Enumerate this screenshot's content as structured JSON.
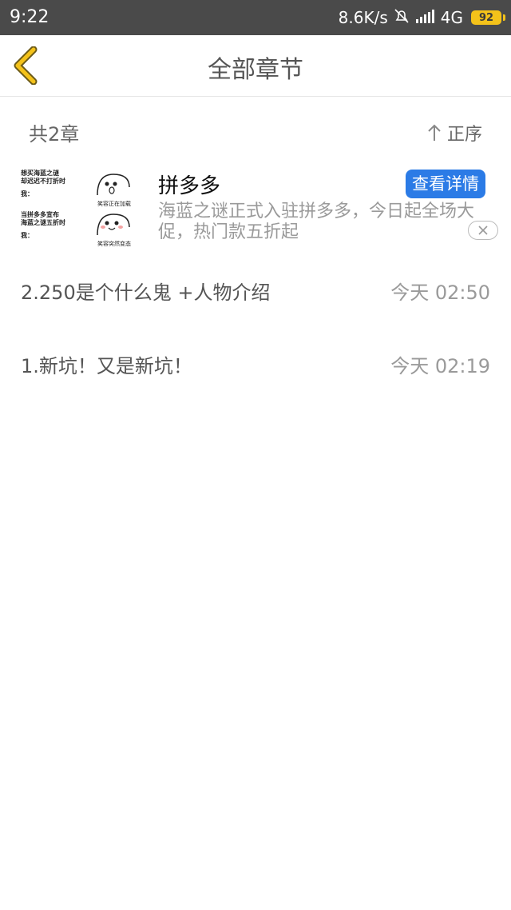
{
  "status": {
    "time": "9:22",
    "speed": "8.6K/s",
    "network": "4G",
    "battery": "92"
  },
  "nav": {
    "title": "全部章节"
  },
  "summary": {
    "count_label": "共2章",
    "sort_label": "正序"
  },
  "ad": {
    "title": "拼多多",
    "description": "海蓝之谜正式入驻拼多多，今日起全场大促，热门款五折起",
    "button_label": "查看详情",
    "image_lines_top": [
      "想买海蓝之谜",
      "却迟迟不打折时",
      "我："
    ],
    "image_lines_bottom": [
      "当拼多多宣布",
      "海蓝之谜五折时",
      "我："
    ],
    "face_caption_top": "笑容正在加载",
    "face_caption_bottom": "笑容突然变态"
  },
  "chapters": [
    {
      "name": "2.250是个什么鬼 +人物介绍",
      "time": "今天 02:50"
    },
    {
      "name": "1.新坑！又是新坑！",
      "time": "今天 02:19"
    }
  ],
  "colors": {
    "accent": "#f4c21a",
    "button": "#2b7be6"
  }
}
